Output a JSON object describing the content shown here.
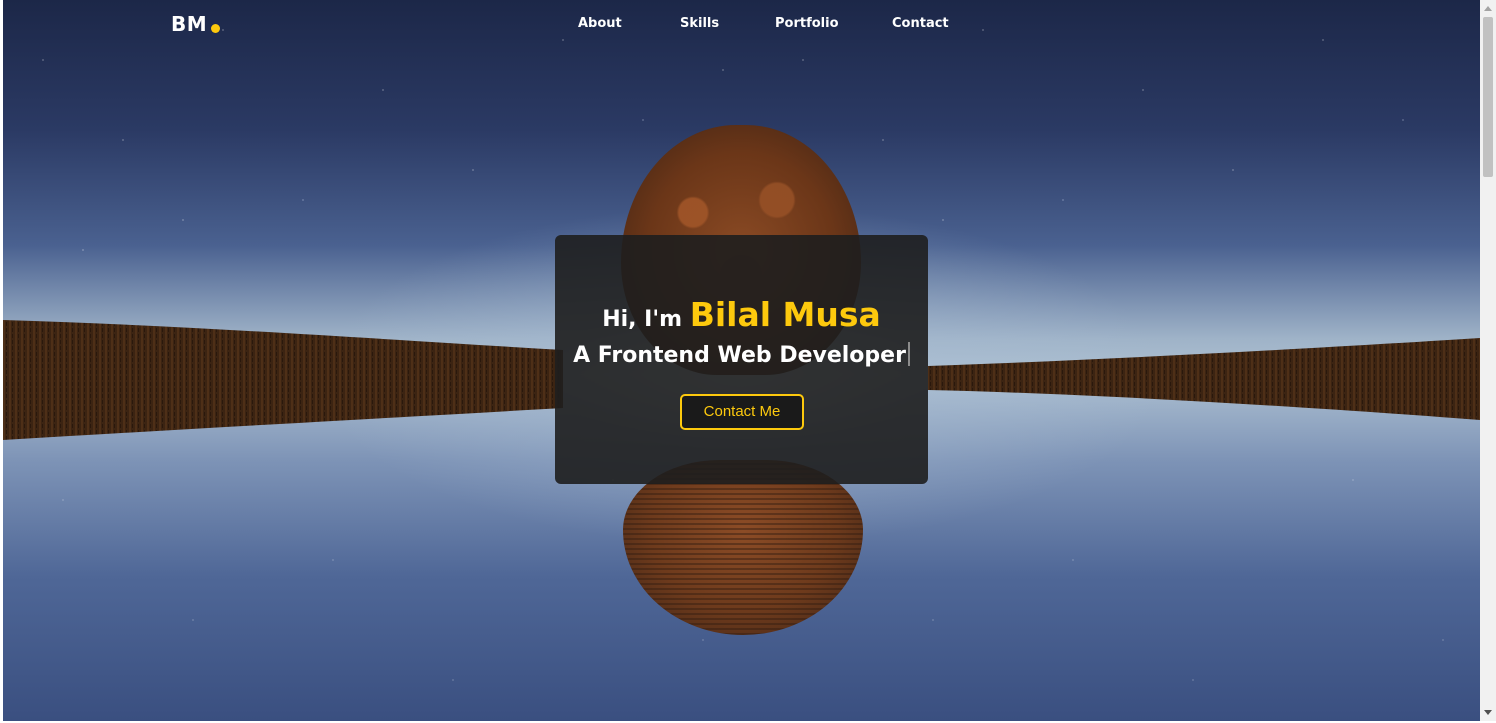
{
  "header": {
    "logo_text": "BM",
    "accent_color": "#fdc90d",
    "nav": [
      {
        "label": "About"
      },
      {
        "label": "Skills"
      },
      {
        "label": "Portfolio"
      },
      {
        "label": "Contact"
      }
    ]
  },
  "hero": {
    "greeting_prefix": "Hi, I'm",
    "name": "Bilal Musa",
    "role": "A Frontend Web Developer",
    "cta_label": "Contact Me"
  },
  "scrollbar": {
    "position": 0
  }
}
